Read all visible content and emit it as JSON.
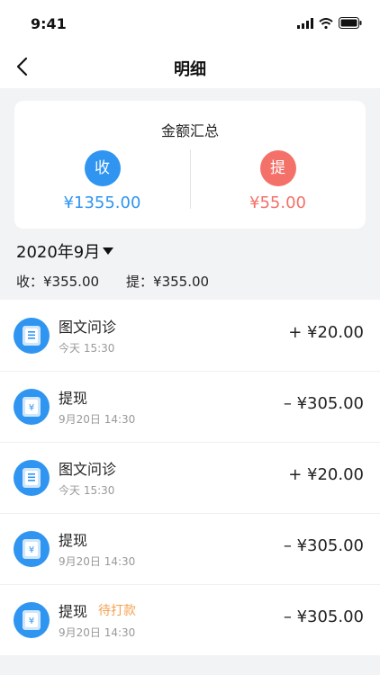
{
  "status_bar": {
    "time": "9:41"
  },
  "nav": {
    "title": "明细"
  },
  "summary": {
    "title": "金额汇总",
    "income_badge": "收",
    "income_amount": "¥1355.00",
    "withdraw_badge": "提",
    "withdraw_amount": "¥55.00",
    "colors": {
      "income": "#2f95f0",
      "withdraw": "#f4716a"
    }
  },
  "month": {
    "label": "2020年9月",
    "income_stat": "收：¥355.00",
    "withdraw_stat": "提：¥355.00"
  },
  "transactions": [
    {
      "icon": "document-icon",
      "title": "图文问诊",
      "status": "",
      "time": "今天 15:30",
      "amount": "+ ¥20.00"
    },
    {
      "icon": "withdraw-icon",
      "title": "提现",
      "status": "",
      "time": "9月20日 14:30",
      "amount": "– ¥305.00"
    },
    {
      "icon": "document-icon",
      "title": "图文问诊",
      "status": "",
      "time": "今天 15:30",
      "amount": "+ ¥20.00"
    },
    {
      "icon": "withdraw-icon",
      "title": "提现",
      "status": "",
      "time": "9月20日 14:30",
      "amount": "– ¥305.00"
    },
    {
      "icon": "withdraw-icon",
      "title": "提现",
      "status": "待打款",
      "time": "9月20日 14:30",
      "amount": "– ¥305.00"
    }
  ]
}
